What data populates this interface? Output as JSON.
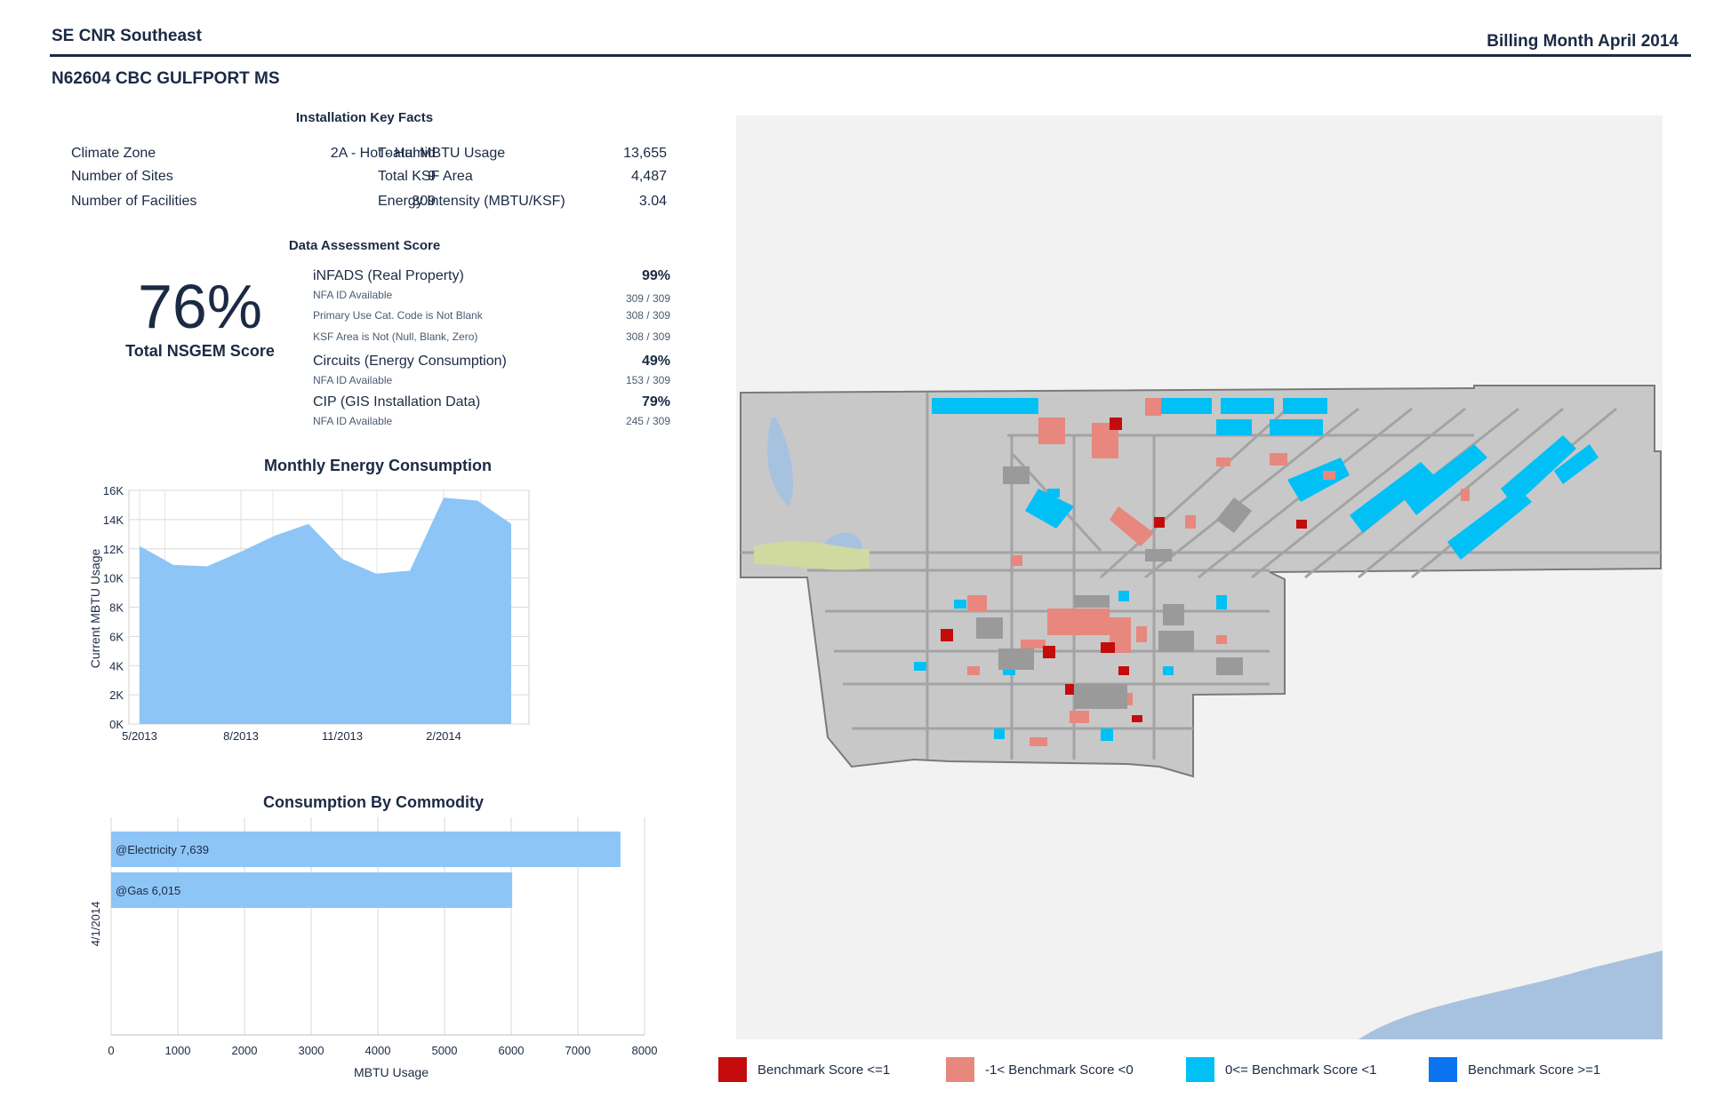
{
  "header": {
    "region": "SE CNR Southeast",
    "billing": "Billing Month April 2014",
    "installation": "N62604 CBC GULFPORT MS"
  },
  "key_facts": {
    "title": "Installation Key Facts",
    "rows": [
      {
        "l1": "Climate Zone",
        "v1": "2A - Hot - Humid",
        "l2": "Toatal MBTU Usage",
        "v2": "13,655"
      },
      {
        "l1": "Number of Sites",
        "v1": "9",
        "l2": "Total KSF Area",
        "v2": "4,487"
      },
      {
        "l1": "Number of Facilities",
        "v1": "309",
        "l2": "Energy Intensity (MBTU/KSF)",
        "v2": "3.04"
      }
    ]
  },
  "data_assessment": {
    "title": "Data Assessment Score",
    "total_score": "76%",
    "total_label": "Total NSGEM Score",
    "groups": [
      {
        "name": "iNFADS (Real Property)",
        "score": "99%",
        "items": [
          {
            "name": "NFA ID Available",
            "value": "309 / 309"
          },
          {
            "name": "Primary Use Cat. Code is Not Blank",
            "value": "308 / 309"
          },
          {
            "name": "KSF Area is Not (Null, Blank, Zero)",
            "value": "308 / 309"
          }
        ]
      },
      {
        "name": "Circuits (Energy Consumption)",
        "score": "49%",
        "items": [
          {
            "name": "NFA ID Available",
            "value": "153 / 309"
          }
        ]
      },
      {
        "name": "CIP (GIS Installation Data)",
        "score": "79%",
        "items": [
          {
            "name": "NFA ID Available",
            "value": "245 / 309"
          }
        ]
      }
    ]
  },
  "chart_data": [
    {
      "type": "area",
      "title": "Monthly Energy Consumption",
      "ylabel": "Current MBTU Usage",
      "xlabel": "",
      "x": [
        "5/2013",
        "6/2013",
        "7/2013",
        "8/2013",
        "9/2013",
        "10/2013",
        "11/2013",
        "12/2013",
        "1/2014",
        "2/2014",
        "3/2014",
        "4/2014"
      ],
      "xticks": [
        "5/2013",
        "8/2013",
        "11/2013",
        "2/2014"
      ],
      "values": [
        12200,
        10900,
        10800,
        11800,
        12900,
        13700,
        11300,
        10300,
        10500,
        15500,
        15300,
        13700
      ],
      "ylim": [
        0,
        16000
      ],
      "yticks": [
        "0K",
        "2K",
        "4K",
        "6K",
        "8K",
        "10K",
        "12K",
        "14K",
        "16K"
      ],
      "color": "#8ec5f7",
      "grid": true
    },
    {
      "type": "bar",
      "orientation": "horizontal",
      "title": "Consumption By Commodity",
      "xlabel": "MBTU Usage",
      "ylabel": "4/1/2014",
      "categories": [
        "@Electricity",
        "@Gas"
      ],
      "values": [
        7639,
        6015
      ],
      "bar_labels": [
        "@Electricity 7,639",
        "@Gas 6,015"
      ],
      "xlim": [
        0,
        8000
      ],
      "xticks": [
        "0",
        "1000",
        "2000",
        "3000",
        "4000",
        "5000",
        "6000",
        "7000",
        "8000"
      ],
      "color": "#8ec5f7",
      "grid": true
    }
  ],
  "legend": [
    {
      "label": "Benchmark Score <=1",
      "color": "#c40c0c"
    },
    {
      "label": "-1< Benchmark Score <0",
      "color": "#e8877d"
    },
    {
      "label": "0<= Benchmark Score <1",
      "color": "#00c0f6"
    },
    {
      "label": "Benchmark Score >=1",
      "color": "#0a74f0"
    }
  ],
  "map": {
    "base_color": "#c8c8c8",
    "road_color": "#a6a6a6",
    "building_color": "#9a9a9a",
    "water_color": "#a7c2df"
  }
}
